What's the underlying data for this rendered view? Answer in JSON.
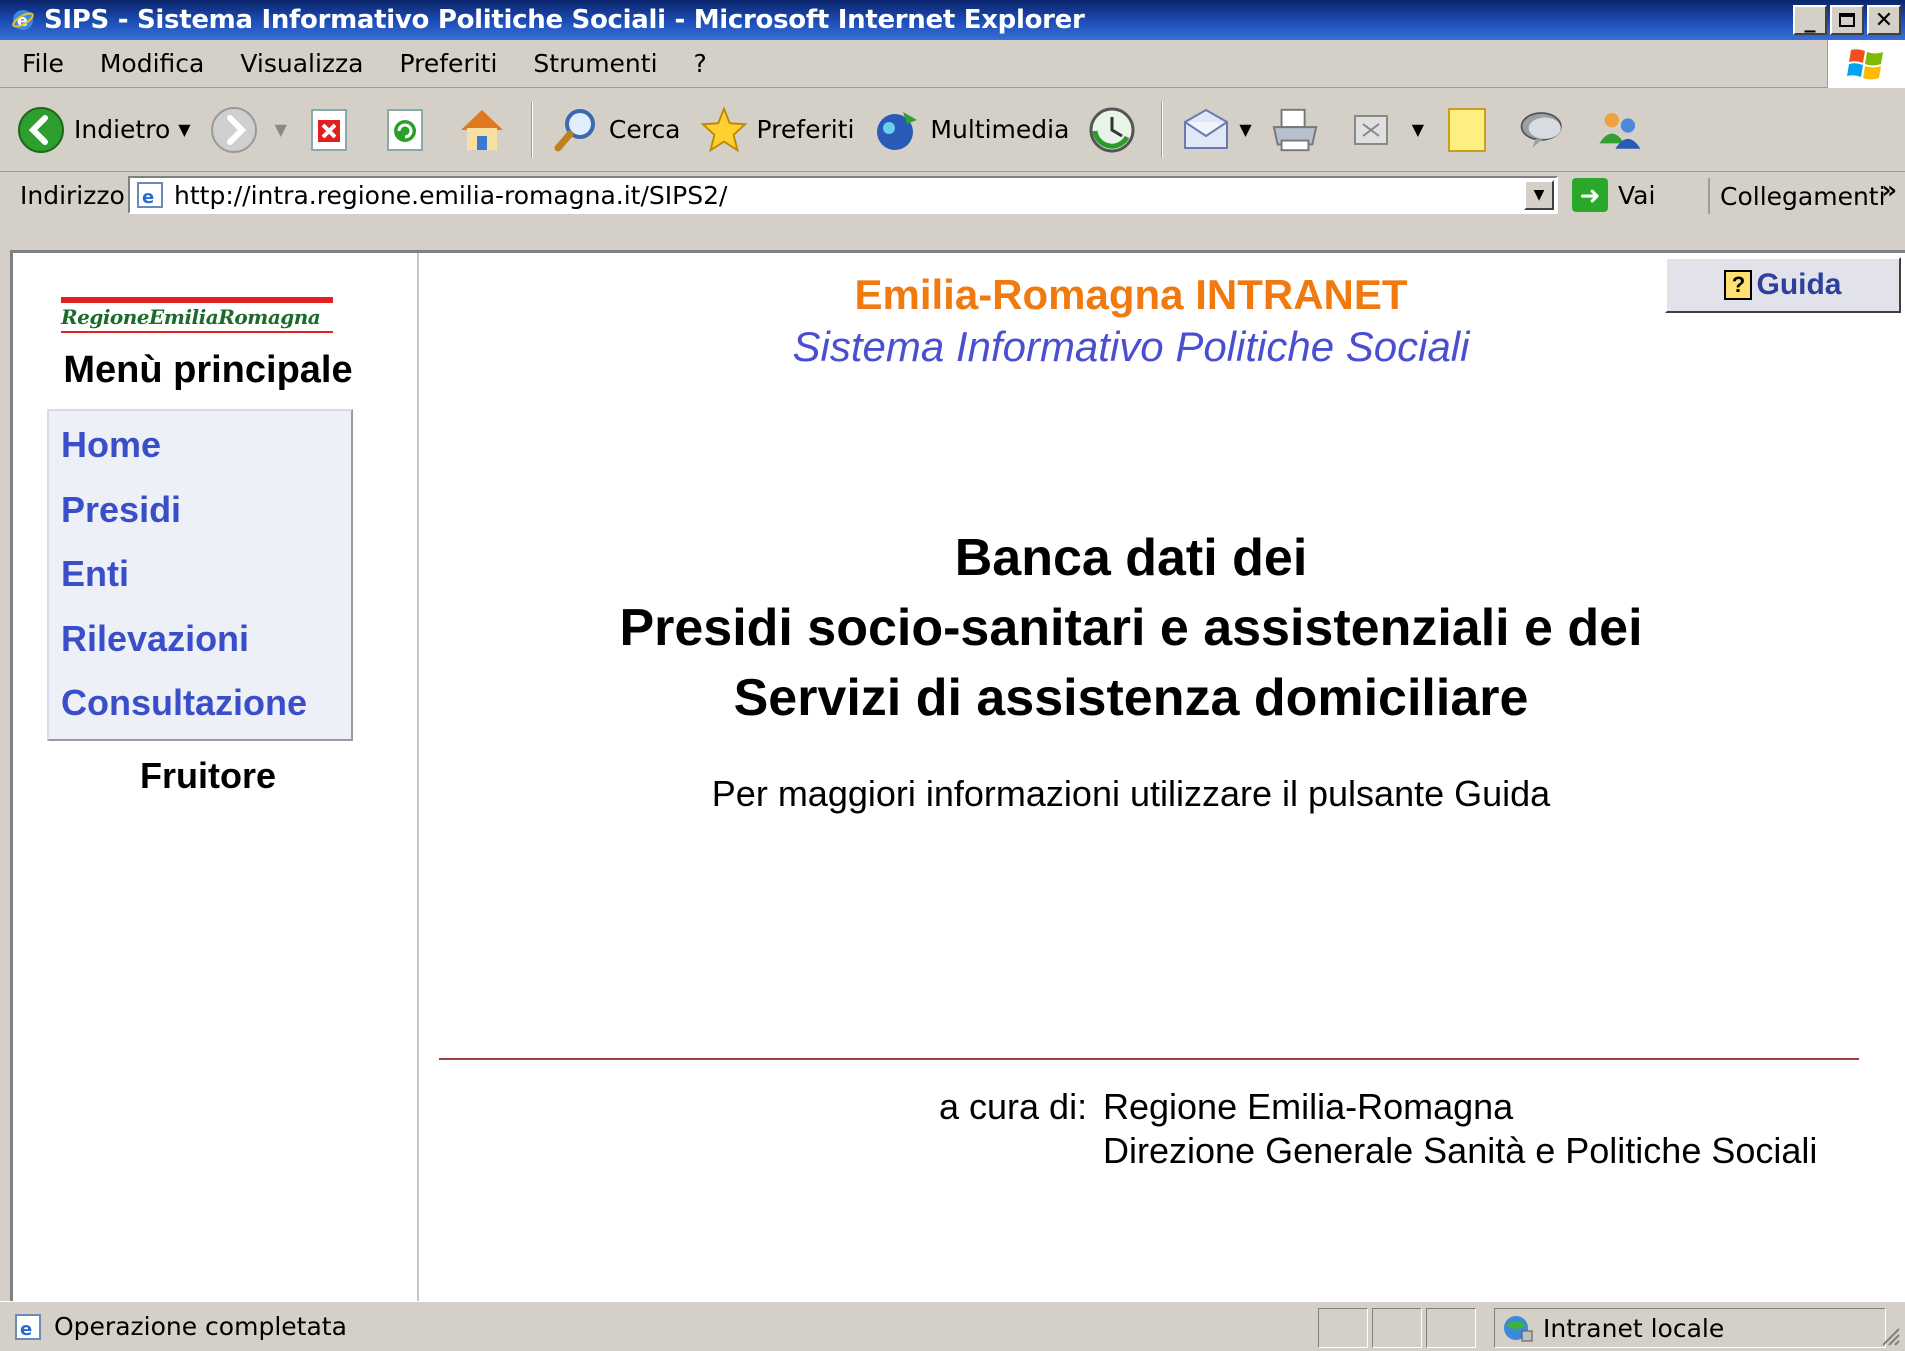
{
  "window": {
    "title": "SIPS - Sistema Informativo Politiche Sociali - Microsoft Internet Explorer",
    "controls": [
      "minimize",
      "maximize",
      "close"
    ]
  },
  "menubar": {
    "items": [
      "File",
      "Modifica",
      "Visualizza",
      "Preferiti",
      "Strumenti",
      "?"
    ]
  },
  "toolbar": {
    "back_label": "Indietro",
    "search_label": "Cerca",
    "favorites_label": "Preferiti",
    "media_label": "Multimedia",
    "icons": [
      "back-icon",
      "forward-icon",
      "stop-icon",
      "refresh-icon",
      "home-icon",
      "search-icon",
      "favorites-icon",
      "media-icon",
      "history-icon",
      "mail-icon",
      "print-icon",
      "edit-icon",
      "discuss-icon",
      "messenger-icon"
    ]
  },
  "address": {
    "label": "Indirizzo",
    "url": "http://intra.regione.emilia-romagna.it/SIPS2/",
    "go_label": "Vai",
    "links_label": "Collegamenti",
    "links_chevron": "»"
  },
  "sidebar": {
    "logo_text": "RegioneEmiliaRomagna",
    "menu_title": "Menù principale",
    "items": [
      "Home",
      "Presidi",
      "Enti",
      "Rilevazioni",
      "Consultazione"
    ],
    "role": "Fruitore"
  },
  "main": {
    "help_label": "Guida",
    "help_symbol": "?",
    "header_title": "Emilia-Romagna INTRANET",
    "header_subtitle": "Sistema Informativo Politiche Sociali",
    "title_line1": "Banca dati dei",
    "title_line2": "Presidi socio-sanitari e assistenziali e dei",
    "title_line3": "Servizi di assistenza domiciliare",
    "info": "Per maggiori informazioni utilizzare il pulsante Guida",
    "credits_label": "a cura di:",
    "credits_line1": "Regione Emilia-Romagna",
    "credits_line2": "Direzione Generale Sanità e Politiche Sociali"
  },
  "statusbar": {
    "text": "Operazione completata",
    "zone": "Intranet locale"
  },
  "colors": {
    "title_orange": "#f07a10",
    "subtitle_blue": "#4a4ed0",
    "menu_link_blue": "#3a4ec8",
    "divider_red": "#a04040"
  }
}
